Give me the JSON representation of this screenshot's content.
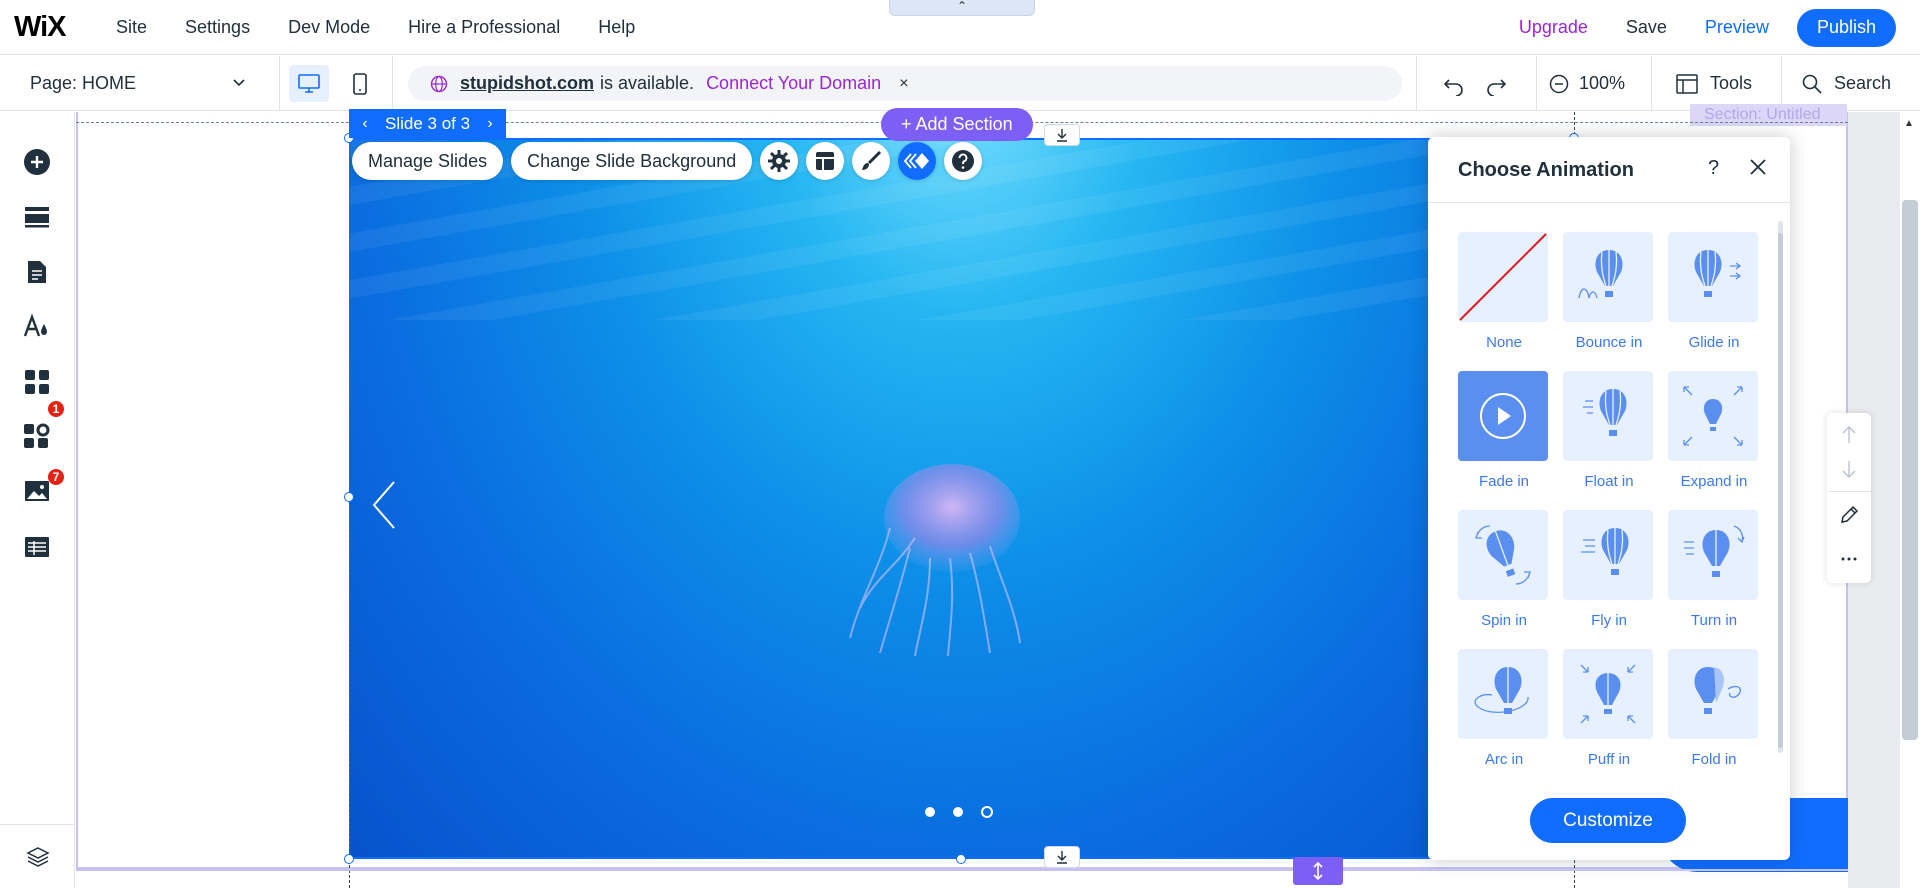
{
  "app": {
    "logo": "WiX",
    "nav": [
      "Site",
      "Settings",
      "Dev Mode",
      "Hire a Professional",
      "Help"
    ],
    "upgrade": "Upgrade",
    "save": "Save",
    "preview": "Preview",
    "publish": "Publish",
    "collapse_glyph": "⌃"
  },
  "secondbar": {
    "page_label": "Page: HOME",
    "domain": {
      "name": "stupidshot.com",
      "available": "is available.",
      "connect": "Connect Your Domain",
      "close": "×"
    },
    "zoom": "100%",
    "tools": "Tools",
    "search": "Search"
  },
  "leftbar": {
    "items": [
      {
        "name": "add-elements-icon"
      },
      {
        "name": "sections-icon"
      },
      {
        "name": "pages-icon"
      },
      {
        "name": "design-icon"
      },
      {
        "name": "apps-icon",
        "badge": "1"
      },
      {
        "name": "business-tools-icon",
        "badge": "7"
      },
      {
        "name": "media-icon"
      },
      {
        "name": "cms-icon"
      }
    ],
    "layers": "layers-icon"
  },
  "canvas": {
    "section_label": "Section: Untitled",
    "slide_tag": "Slide 3 of 3",
    "add_section": "+ Add Section",
    "manage_slides": "Manage Slides",
    "change_bg": "Change Slide Background",
    "slides_count": 3,
    "active_slide": 3
  },
  "animation_panel": {
    "title": "Choose Animation",
    "help": "?",
    "items": [
      {
        "label": "None"
      },
      {
        "label": "Bounce in"
      },
      {
        "label": "Glide in"
      },
      {
        "label": "Fade in",
        "selected": true
      },
      {
        "label": "Float in"
      },
      {
        "label": "Expand in"
      },
      {
        "label": "Spin in"
      },
      {
        "label": "Fly in"
      },
      {
        "label": "Turn in"
      },
      {
        "label": "Arc in"
      },
      {
        "label": "Puff in"
      },
      {
        "label": "Fold in"
      }
    ],
    "customize": "Customize"
  },
  "colors": {
    "accent": "#116dff",
    "purple": "#7d5ff5",
    "upgrade": "#9a27d5",
    "badge": "#e62214"
  }
}
